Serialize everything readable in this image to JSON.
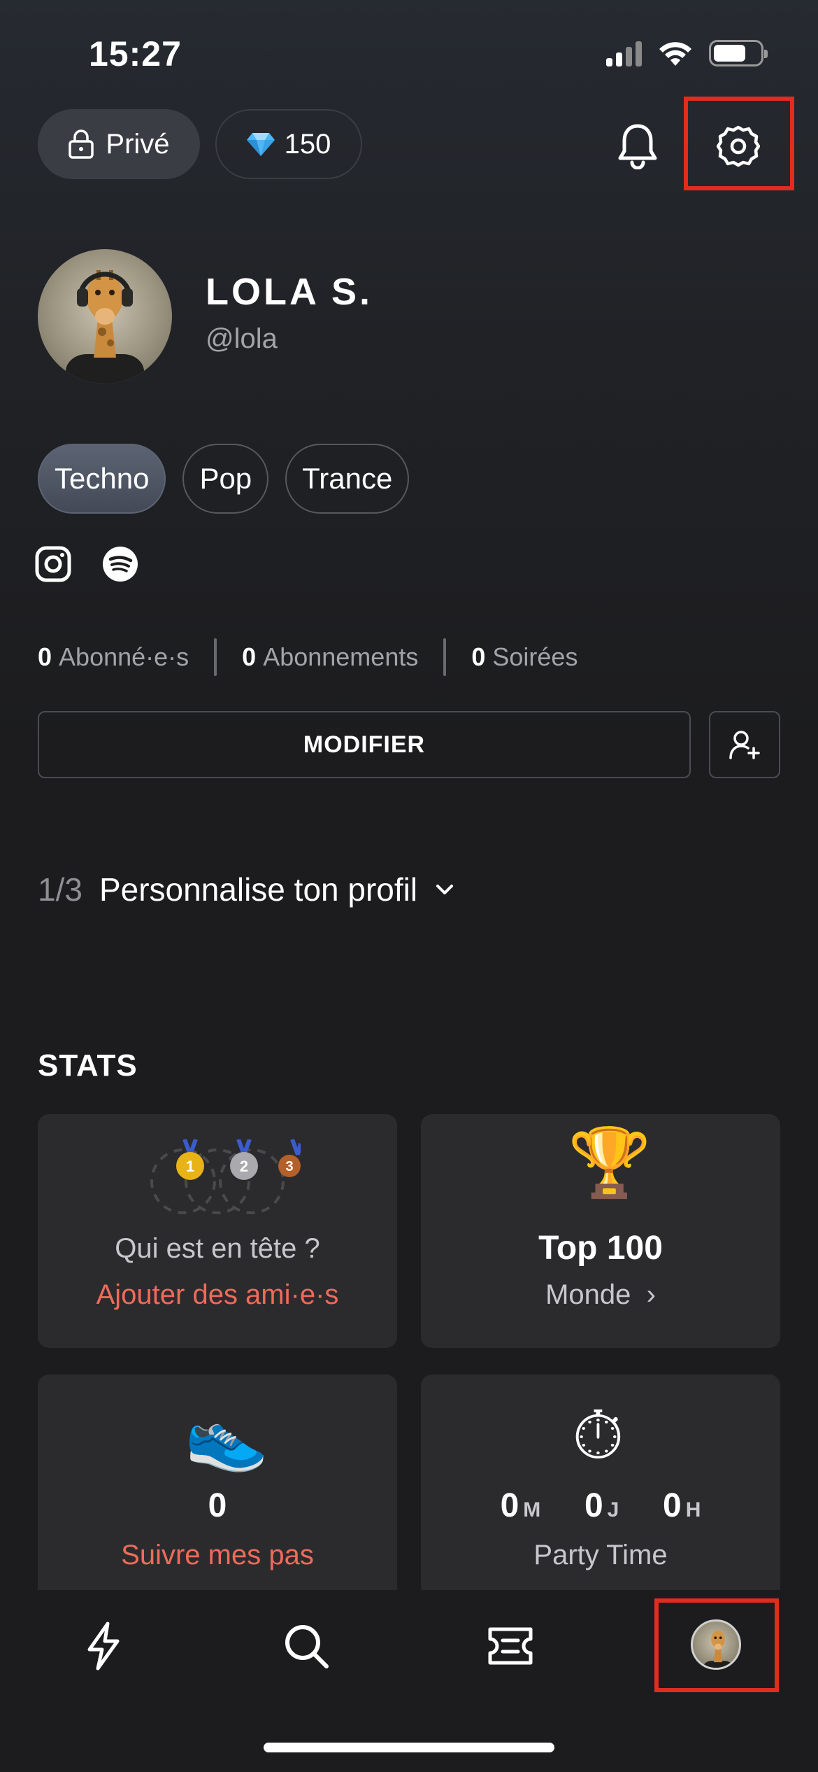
{
  "status_bar": {
    "time": "15:27"
  },
  "header": {
    "privacy_label": "Privé",
    "gems_count": "150",
    "icons": [
      "lock-icon",
      "gem-icon",
      "bell-icon",
      "settings-icon"
    ]
  },
  "profile": {
    "name": "LOLA S.",
    "handle": "@lola",
    "tags": [
      {
        "label": "Techno",
        "active": true
      },
      {
        "label": "Pop",
        "active": false
      },
      {
        "label": "Trance",
        "active": false
      }
    ],
    "social_icons": [
      "instagram-icon",
      "spotify-icon"
    ]
  },
  "counts": {
    "followers_value": "0",
    "followers_label": "Abonné·e·s",
    "following_value": "0",
    "following_label": "Abonnements",
    "parties_value": "0",
    "parties_label": "Soirées"
  },
  "actions": {
    "modify_label": "MODIFIER"
  },
  "personalize": {
    "fraction": "1/3",
    "label": "Personnalise ton profil"
  },
  "stats": {
    "title": "STATS",
    "leaderboard": {
      "question": "Qui est en tête ?",
      "link": "Ajouter des ami·e·s"
    },
    "top": {
      "title": "Top 100",
      "scope": "Monde",
      "chevron": "›"
    },
    "steps": {
      "value": "0",
      "link": "Suivre mes pas"
    },
    "party_time": {
      "months": "0",
      "months_unit": "M",
      "days": "0",
      "days_unit": "J",
      "hours": "0",
      "hours_unit": "H",
      "label": "Party Time"
    }
  },
  "bottom_nav": [
    "bolt-icon",
    "search-icon",
    "ticket-icon",
    "profile-avatar"
  ],
  "colors": {
    "accent": "#ef6b5a",
    "highlight": "#e02d1e",
    "card": "#2b2b2d"
  }
}
